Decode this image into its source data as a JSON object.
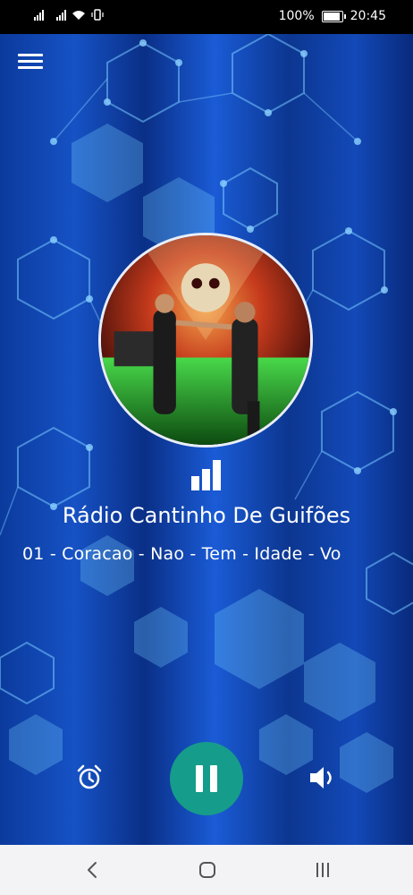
{
  "status_bar": {
    "battery_text": "100%",
    "time": "20:45",
    "battery_level": 1.0,
    "icons": [
      "signal-icon",
      "signal-icon",
      "wifi-icon",
      "vibrate-icon",
      "battery-icon"
    ]
  },
  "player": {
    "station_name": "Rádio Cantinho De Guifões",
    "track_title": "01 - Coracao - Nao - Tem - Idade - Vo",
    "state": "playing",
    "accent_color": "#169c8a",
    "background_color": "#1652c5"
  },
  "controls": {
    "menu_icon": "hamburger-menu-icon",
    "alarm_icon": "alarm-clock-icon",
    "play_pause_icon": "pause-icon",
    "volume_icon": "volume-icon"
  },
  "navigation_bar": {
    "icons": [
      "back-icon",
      "home-icon",
      "recents-icon"
    ]
  }
}
